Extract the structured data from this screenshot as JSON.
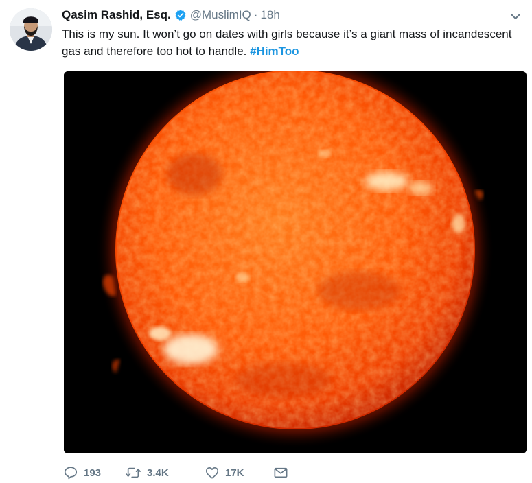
{
  "tweet": {
    "author": {
      "name": "Qasim Rashid, Esq.",
      "handle": "@MuslimIQ",
      "separator": "·",
      "time": "18h",
      "avatar_icon": "avatar-photo",
      "verified_icon": "verified-badge-icon",
      "verified_color": "#1da1f2"
    },
    "text_part1": "This is my sun. It won’t go on dates with girls because it’s a giant mass of incandescent gas and therefore too hot to handle. ",
    "hashtag": "#HimToo",
    "hashtag_color": "#1b95e0",
    "media": {
      "icon": "sun-photo"
    },
    "actions": {
      "reply_count": "193",
      "retweet_count": "3.4K",
      "like_count": "17K",
      "reply_icon": "reply-icon",
      "retweet_icon": "retweet-icon",
      "like_icon": "heart-icon",
      "dm_icon": "envelope-icon"
    }
  }
}
